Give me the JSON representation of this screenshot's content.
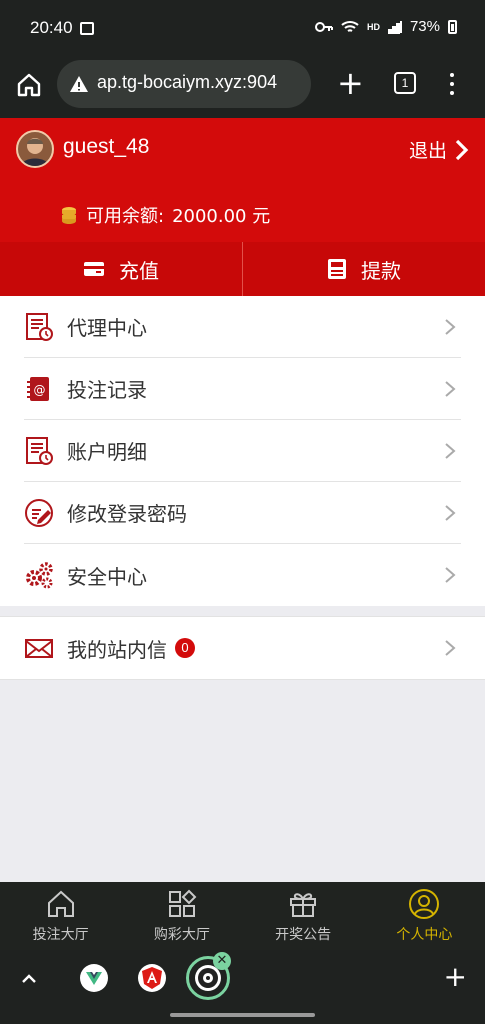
{
  "status_bar": {
    "time": "20:40",
    "battery": "73%"
  },
  "browser": {
    "url": "ap.tg-bocaiym.xyz:904",
    "tab_count": "1"
  },
  "header": {
    "username": "guest_48",
    "logout_label": "退出",
    "balance_label": "可用余额:",
    "balance_value": "2000.00 元",
    "recharge_label": "充值",
    "withdraw_label": "提款"
  },
  "menu": {
    "items": [
      {
        "label": "代理中心",
        "icon": "document-clock-icon"
      },
      {
        "label": "投注记录",
        "icon": "address-book-icon"
      },
      {
        "label": "账户明细",
        "icon": "document-clock-icon"
      },
      {
        "label": "修改登录密码",
        "icon": "edit-icon"
      },
      {
        "label": "安全中心",
        "icon": "gears-icon"
      }
    ],
    "messages": {
      "label": "我的站内信",
      "badge": "0",
      "icon": "envelope-icon"
    }
  },
  "bottom_nav": {
    "items": [
      {
        "label": "投注大厅",
        "icon": "home-icon"
      },
      {
        "label": "购彩大厅",
        "icon": "grid-icon"
      },
      {
        "label": "开奖公告",
        "icon": "gift-icon"
      },
      {
        "label": "个人中心",
        "icon": "user-icon"
      }
    ],
    "active": "个人中心"
  },
  "colors": {
    "primary_red": "#d30b0b",
    "nav_active": "#d4b300"
  }
}
